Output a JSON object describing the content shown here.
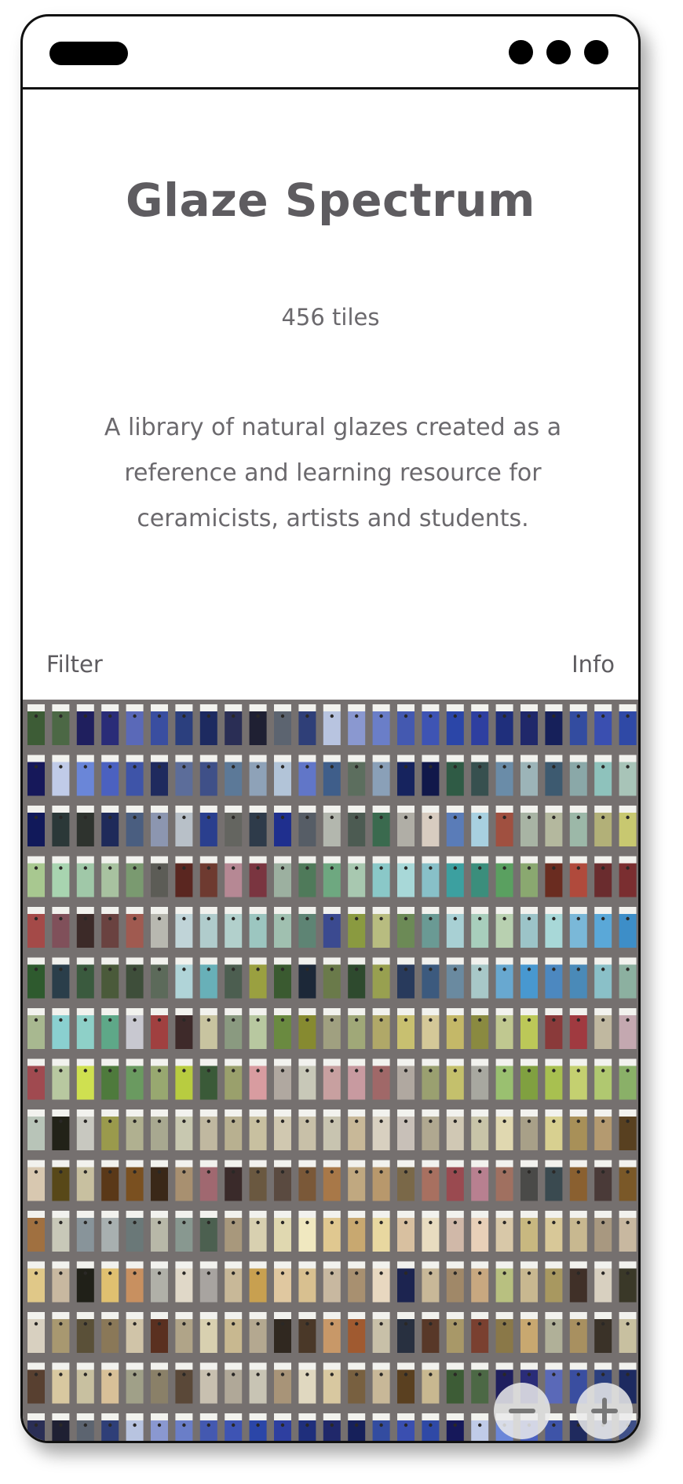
{
  "app": {
    "title": "Glaze Spectrum",
    "count": "456 tiles",
    "description": "A library of natural glazes created as a reference and learning resource for ceramicists, artists and students."
  },
  "nav": {
    "filter_label": "Filter",
    "info_label": "Info"
  },
  "grid": {
    "columns": 25,
    "rows": 15,
    "background": "#75706f",
    "colors": [
      "#3d5c36",
      "#4c6845",
      "#1f1f5e",
      "#2a2c78",
      "#5a69b8",
      "#3a4ea0",
      "#2b3f7e",
      "#1d2a60",
      "#2a2e55",
      "#1f2033",
      "#5c6470",
      "#2f3f78",
      "#b8c4e0",
      "#8a98d0",
      "#6a7ec8",
      "#4459b0",
      "#3e54b4",
      "#2b46a8",
      "#2e3fa0",
      "#1f2f7c",
      "#20286a",
      "#16205a",
      "#334ca0",
      "#3a4fb0",
      "#2f49a6",
      "#16185a",
      "#c0cbe8",
      "#6a86d8",
      "#4b61c0",
      "#3e54a8",
      "#1f2a5e",
      "#5c6d9a",
      "#3f5088",
      "#5c7998",
      "#8ea2b8",
      "#b2c4d8",
      "#6176c8",
      "#3f5e8a",
      "#5c6e5e",
      "#8aa0b8",
      "#16235e",
      "#11184a",
      "#2f5b45",
      "#37504f",
      "#6a8ca8",
      "#9cb4b8",
      "#3d5a70",
      "#8aa8a8",
      "#8ec2bc",
      "#a8c4b8",
      "#11195a",
      "#2b3838",
      "#2e332e",
      "#1e2a5a",
      "#4a5e80",
      "#8c96b0",
      "#b8c0c8",
      "#2a3f8e",
      "#646560",
      "#2e3b4a",
      "#1f2f8e",
      "#565d66",
      "#b3b7ae",
      "#4c5b52",
      "#3a6a4e",
      "#b0aea6",
      "#d8ccc0",
      "#5a7cb8",
      "#a8d0e0",
      "#a05040",
      "#a8b4a4",
      "#b4b89e",
      "#9cb8a8",
      "#b2b078",
      "#c8c870",
      "#a8c890",
      "#a8d4b0",
      "#a0c8a8",
      "#a8c2a0",
      "#7a9a70",
      "#5c5c56",
      "#5a2620",
      "#6e3a30",
      "#b68894",
      "#7a3540",
      "#9cb0a0",
      "#4f7a5a",
      "#6ea880",
      "#a8c8b0",
      "#8ac8c8",
      "#a8d8d8",
      "#88c0c8",
      "#3ca0a0",
      "#3b8e7c",
      "#5aa060",
      "#8aa870",
      "#6a2c20",
      "#b04a3c",
      "#6a2c2e",
      "#7a2e30",
      "#a44a48",
      "#80505a",
      "#3c2a28",
      "#6a4240",
      "#a05a50",
      "#b8b8b0",
      "#c0d4d8",
      "#b0cccc",
      "#b2d0cc",
      "#9cc6c0",
      "#a0c0b0",
      "#5e8474",
      "#3b4a90",
      "#8a9a40",
      "#b8bc80",
      "#6c8a56",
      "#6a9a94",
      "#a8d0d4",
      "#a8cebc",
      "#b8d0b0",
      "#9cc4c8",
      "#a8d8d8",
      "#7ab8d8",
      "#5aa8d8",
      "#3d8ec8",
      "#2e5a2e",
      "#2a3e4a",
      "#3a5a3e",
      "#4a5a3a",
      "#3e4e3a",
      "#5c6a5a",
      "#b0d4d8",
      "#68b0b8",
      "#4c5e50",
      "#9aa040",
      "#3a5a30",
      "#1c2838",
      "#6a7a4a",
      "#2e4a2e",
      "#98a050",
      "#283a5c",
      "#3c5a7e",
      "#6a8aa0",
      "#a8c8c8",
      "#68a8d0",
      "#4898d0",
      "#4c88c0",
      "#4a8ab8",
      "#8ac0c8",
      "#8cb0a0",
      "#a8b890",
      "#8ad0d0",
      "#8ed0c8",
      "#5ea888",
      "#c8c8d0",
      "#a04040",
      "#3e2a2a",
      "#c8c4a0",
      "#8a9a80",
      "#b8c8a0",
      "#6a8a40",
      "#868a30",
      "#a0a080",
      "#a0a878",
      "#b0a868",
      "#c8c070",
      "#d4c898",
      "#c4b868",
      "#8a8a40",
      "#c0c890",
      "#bcc858",
      "#8a3a3a",
      "#a03a40",
      "#c0b8a0",
      "#c4a8b0",
      "#a04a50",
      "#b8c8a0",
      "#cfe050",
      "#4e7a3c",
      "#6a9a60",
      "#98a870",
      "#b8cc40",
      "#3a5a38",
      "#9aa06c",
      "#d89ca0",
      "#b0a8a0",
      "#c8c8b8",
      "#c8a0a0",
      "#c89aa0",
      "#a06868",
      "#b0a8a0",
      "#9aa070",
      "#c4c06c",
      "#a8a8a0",
      "#9ac070",
      "#80a040",
      "#a8c050",
      "#c4d070",
      "#b0c870",
      "#8ab068",
      "#b8c4b8",
      "#222218",
      "#c8c8c0",
      "#9a9a4c",
      "#b0b090",
      "#a8a890",
      "#c8c8b0",
      "#c0b8a0",
      "#b8b090",
      "#c8c0a0",
      "#d0c8b0",
      "#c8c0a8",
      "#c8c4b0",
      "#c8b898",
      "#d8d0c0",
      "#c8c0b8",
      "#b0a890",
      "#d0c8b4",
      "#c8c4a8",
      "#e0d8b0",
      "#a8a088",
      "#d8d090",
      "#a89058",
      "#b49a70",
      "#584020",
      "#d8c8b0",
      "#584818",
      "#c8c0a0",
      "#5a3818",
      "#7a5020",
      "#3a2818",
      "#a89070",
      "#a06870",
      "#3a2a2a",
      "#6a5840",
      "#5a4a40",
      "#7a5838",
      "#a87848",
      "#c0a880",
      "#b8986c",
      "#7a6848",
      "#a87060",
      "#9a4a50",
      "#b88090",
      "#a07060",
      "#4a4a48",
      "#3a4a50",
      "#8a6030",
      "#4a3a38",
      "#7a5828",
      "#a07040",
      "#c8c8b8",
      "#88949a",
      "#a8b0b0",
      "#6a7878",
      "#b8b8a8",
      "#889890",
      "#4c6050",
      "#a8987c",
      "#d8d0b0",
      "#e0d8b0",
      "#f0e8c0",
      "#e0c890",
      "#c8a870",
      "#e8d8a0",
      "#d8c0a0",
      "#e8dcc0",
      "#d0b8a8",
      "#e8d0b8",
      "#d8c8a8",
      "#c8b880",
      "#d8c898",
      "#c8b890",
      "#a89880",
      "#c8b8a0",
      "#e0c888",
      "#c8b8a0",
      "#202018",
      "#e0c070",
      "#c89060",
      "#b0b0a8",
      "#e0d8c8",
      "#a8a4a0",
      "#c8b898",
      "#c8a050",
      "#e0c8a0",
      "#d8c090",
      "#c8b8a0",
      "#a89070",
      "#e8d8c0",
      "#1c2450",
      "#c8b898",
      "#a08868",
      "#c8a880",
      "#b8c080",
      "#c8b890",
      "#a89860",
      "#403028",
      "#d8d0c0",
      "#3a3828",
      "#d8d0c0",
      "#a89870",
      "#5a5038",
      "#8a7858",
      "#d0c4a8",
      "#5a3020",
      "#b0a488",
      "#d8d0b0",
      "#c8b890",
      "#b4a890",
      "#302820",
      "#4a3828",
      "#c89868",
      "#a05a30",
      "#c8c0a8",
      "#283040",
      "#583828",
      "#a89868",
      "#7a4030",
      "#8a7848",
      "#c8a870",
      "#b0b098",
      "#a89060",
      "#3a3228",
      "#c8c0a0",
      "#584030",
      "#d8c8a0",
      "#c8c0a0",
      "#d8c098",
      "#a0a088",
      "#8a8068",
      "#5a4838",
      "#c8c0b0",
      "#b0a898",
      "#c8c4b4",
      "#a89478",
      "#e0d8c0",
      "#d8c8a0",
      "#786040",
      "#c8b898",
      "#5a4020",
      "#c8b890"
    ]
  },
  "controls": {
    "zoom_out": "minus-icon",
    "zoom_in": "plus-icon"
  }
}
